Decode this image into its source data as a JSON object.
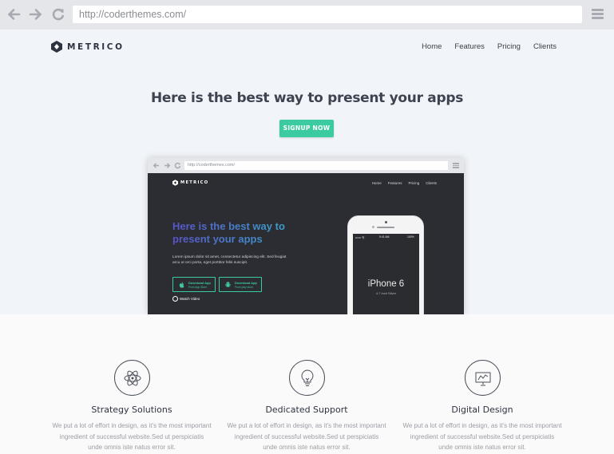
{
  "browser": {
    "url": "http://coderthemes.com/"
  },
  "brand": {
    "name": "METRICO"
  },
  "nav": {
    "items": [
      "Home",
      "Features",
      "Pricing",
      "Clients"
    ]
  },
  "hero": {
    "title": "Here is the best way to present your apps",
    "cta_label": "SIGNUP NOW"
  },
  "preview": {
    "url": "http://coderthemes.com/",
    "brand": "METRICO",
    "nav": [
      "Home",
      "Features",
      "Pricing",
      "Clients"
    ],
    "title": "Here is the best way to present your apps",
    "description": "Lorem ipsum dolor sit amet, consectetur adipiscing elit. Sed feugiat arcu ut orci porta, eget porttitor felis suscipit.",
    "store_buttons": [
      {
        "label": "Download App",
        "sub": "From App Store"
      },
      {
        "label": "Download App",
        "sub": "From play store"
      }
    ],
    "watch_label": "Watch Video",
    "phone": {
      "name": "iPhone 6",
      "subtitle": "4.7 inch Silver",
      "status_left": "•••••• 令",
      "status_time": "9:41 AM",
      "status_right": "100%"
    }
  },
  "features": [
    {
      "icon": "atom-icon",
      "title": "Strategy Solutions",
      "text": "We put a lot of effort in design, as it's the most important ingredient of successful website.Sed ut perspiciatis unde omnis iste natus error sit."
    },
    {
      "icon": "lightbulb-icon",
      "title": "Dedicated Support",
      "text": "We put a lot of effort in design, as it's the most important ingredient of successful website.Sed ut perspiciatis unde omnis iste natus error sit."
    },
    {
      "icon": "presentation-board-icon",
      "title": "Digital Design",
      "text": "We put a lot of effort in design, as it's the most important ingredient of successful website.Sed ut perspiciatis unde omnis iste natus error sit."
    }
  ],
  "colors": {
    "accent": "#3ccba0",
    "hero_bg": "#f1f4f8",
    "preview_bg": "#2b2d33",
    "chrome": "#e4e6ea"
  }
}
